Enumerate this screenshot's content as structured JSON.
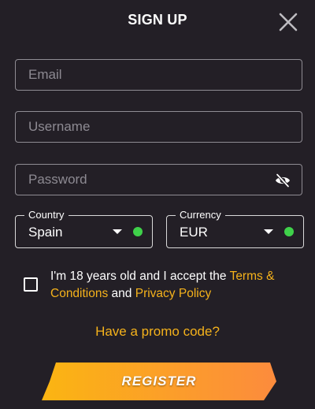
{
  "dialog": {
    "title": "SIGN UP"
  },
  "form": {
    "email": {
      "placeholder": "Email",
      "value": ""
    },
    "username": {
      "placeholder": "Username",
      "value": ""
    },
    "password": {
      "placeholder": "Password",
      "value": ""
    },
    "country": {
      "label": "Country",
      "selected": "Spain"
    },
    "currency": {
      "label": "Currency",
      "selected": "EUR"
    },
    "consent": {
      "text_before": "I'm 18 years old and I accept the ",
      "terms_link": "Terms & Conditions",
      "text_and": " and ",
      "privacy_link": "Privacy Policy",
      "checked": false
    },
    "promo_link": "Have a promo code?",
    "register_label": "REGISTER"
  },
  "icons": {
    "close": "close-icon",
    "eye": "eye-slash-icon",
    "caret": "chevron-down-icon",
    "valid": "valid-dot-icon"
  },
  "colors": {
    "background": "#231f26",
    "accent": "#f5b21b",
    "valid": "#3fd14a",
    "button_start": "#fbb512",
    "button_end": "#fc8b3d"
  }
}
